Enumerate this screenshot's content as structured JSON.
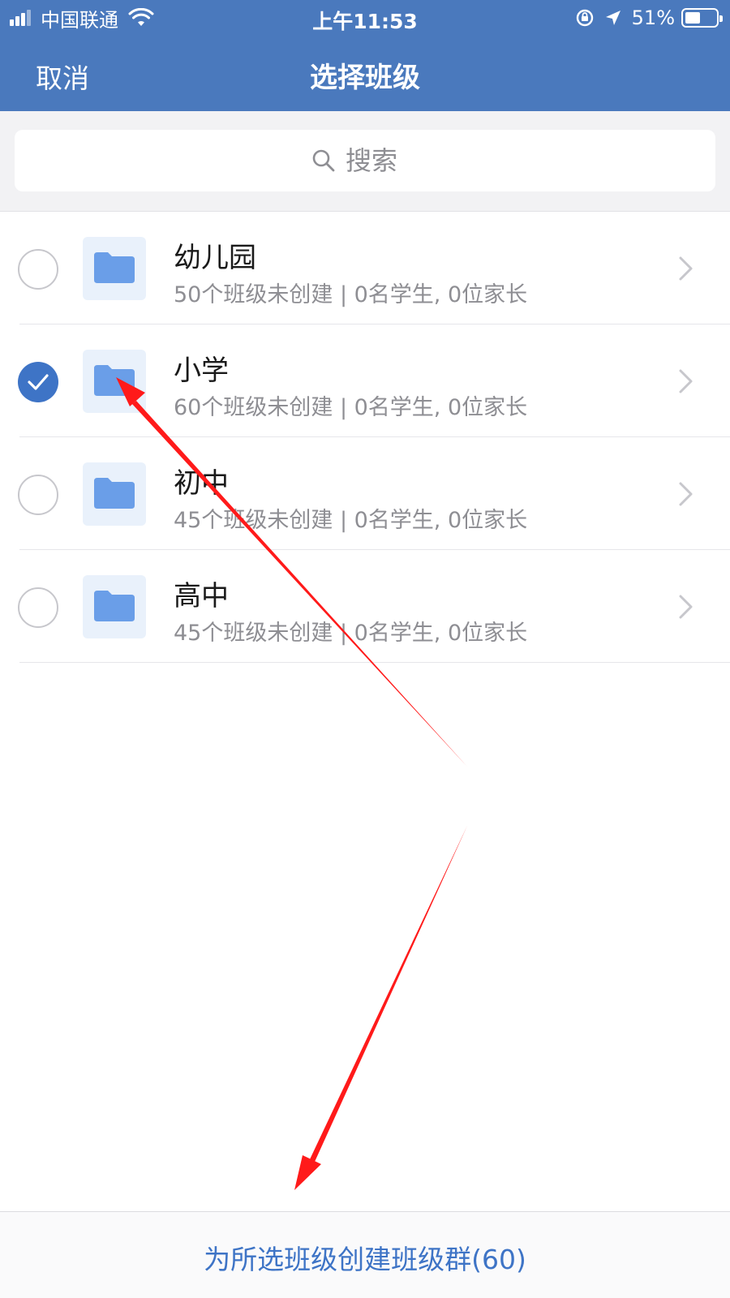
{
  "status_bar": {
    "carrier": "中国联通",
    "time": "上午11:53",
    "battery_percent": "51%",
    "battery_level": 0.51,
    "icons": [
      "signal-icon",
      "wifi-icon",
      "orientation-lock-icon",
      "location-icon",
      "battery-icon"
    ]
  },
  "nav": {
    "cancel_label": "取消",
    "title": "选择班级"
  },
  "search": {
    "placeholder": "搜索",
    "value": ""
  },
  "list": {
    "items": [
      {
        "title": "幼儿园",
        "subtitle": "50个班级未创建 | 0名学生, 0位家长",
        "checked": false
      },
      {
        "title": "小学",
        "subtitle": "60个班级未创建 | 0名学生, 0位家长",
        "checked": true
      },
      {
        "title": "初中",
        "subtitle": "45个班级未创建 | 0名学生, 0位家长",
        "checked": false
      },
      {
        "title": "高中",
        "subtitle": "45个班级未创建 | 0名学生, 0位家长",
        "checked": false
      }
    ]
  },
  "bottom": {
    "action_label": "为所选班级创建班级群(60)"
  },
  "colors": {
    "header_bg": "#4a79bd",
    "accent": "#3e74c6",
    "folder_icon": "#6a9ee8",
    "folder_tile_bg": "#e9f1fb",
    "annotation_arrow": "#ff1a1a"
  }
}
